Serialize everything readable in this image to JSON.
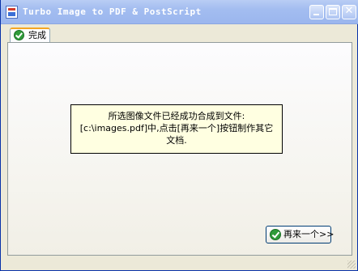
{
  "window": {
    "title": "Turbo Image to PDF & PostScript"
  },
  "tabs": [
    {
      "label": "完成",
      "icon": "check-circle-icon",
      "active": true
    }
  ],
  "message": {
    "lines": [
      "所选图像文件已经成功合成到文件:",
      "[c:\\images.pdf]中,点击[再来一个]按钮制作其它",
      "文档."
    ]
  },
  "buttons": {
    "again_label": "再来一个>>",
    "again_icon": "check-circle-icon"
  },
  "colors": {
    "message_background": "#ffffe1",
    "tab_accent": "#f5a623",
    "check_green": "#2f9b3a"
  }
}
